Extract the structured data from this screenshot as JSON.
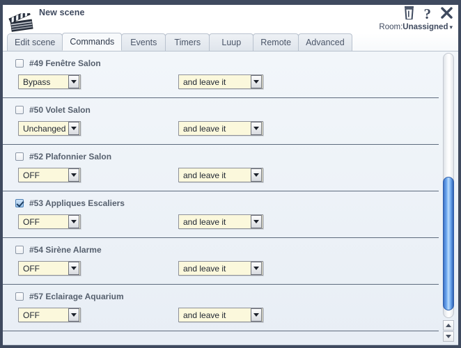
{
  "header": {
    "icon": "clapperboard-icon",
    "scene_title": "New scene",
    "trash_icon": "trash-icon",
    "help_icon": "?",
    "close_icon": "close-icon",
    "room_label": "Room:",
    "room_value": "Unassigned",
    "room_caret": "▾"
  },
  "tabs": [
    {
      "label": "Edit scene",
      "active": false
    },
    {
      "label": "Commands",
      "active": true
    },
    {
      "label": "Events",
      "active": false
    },
    {
      "label": "Timers",
      "active": false
    },
    {
      "label": "Luup",
      "active": false
    },
    {
      "label": "Remote",
      "active": false
    },
    {
      "label": "Advanced",
      "active": false
    }
  ],
  "commands": [
    {
      "checked": false,
      "label": "#49 Fenêtre Salon",
      "action": "Bypass",
      "modifier": "and leave it"
    },
    {
      "checked": false,
      "label": "#50 Volet Salon",
      "action": "Unchanged",
      "modifier": "and leave it"
    },
    {
      "checked": false,
      "label": "#52 Plafonnier Salon",
      "action": "OFF",
      "modifier": "and leave it"
    },
    {
      "checked": true,
      "label": "#53 Appliques Escaliers",
      "action": "OFF",
      "modifier": "and leave it"
    },
    {
      "checked": false,
      "label": "#54 Sirène Alarme",
      "action": "OFF",
      "modifier": "and leave it"
    },
    {
      "checked": false,
      "label": "#57 Eclairage Aquarium",
      "action": "OFF",
      "modifier": "and leave it"
    }
  ],
  "scrollbar": {
    "up_arrow": "scroll-up-icon",
    "down_arrow": "scroll-down-icon"
  },
  "colors": {
    "chrome": "#3f4a5f",
    "content_bg": "#f0f5fa",
    "select_bg": "#fbf8dc",
    "thumb": "#6ea9f0",
    "label_text": "#56606e"
  }
}
